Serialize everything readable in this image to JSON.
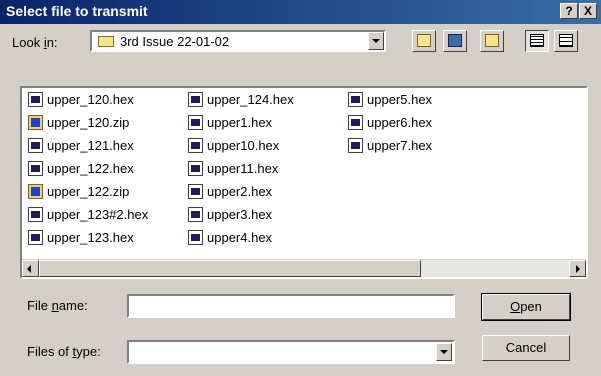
{
  "window": {
    "title": "Select file to transmit",
    "help_label": "?",
    "close_label": "X"
  },
  "lookin": {
    "label_pre": "Look ",
    "label_key": "i",
    "label_post": "n:",
    "value": "3rd Issue 22-01-02"
  },
  "toolbar": {
    "icons": [
      "up-one-level-icon",
      "desktop-icon",
      "new-folder-icon",
      "list-view-icon",
      "details-view-icon"
    ]
  },
  "files": [
    {
      "name": "upper_120.hex",
      "type": "hex"
    },
    {
      "name": "upper_120.zip",
      "type": "zip"
    },
    {
      "name": "upper_121.hex",
      "type": "hex"
    },
    {
      "name": "upper_122.hex",
      "type": "hex"
    },
    {
      "name": "upper_122.zip",
      "type": "zip"
    },
    {
      "name": "upper_123#2.hex",
      "type": "hex"
    },
    {
      "name": "upper_123.hex",
      "type": "hex"
    },
    {
      "name": "upper_124.hex",
      "type": "hex"
    },
    {
      "name": "upper1.hex",
      "type": "hex"
    },
    {
      "name": "upper10.hex",
      "type": "hex"
    },
    {
      "name": "upper11.hex",
      "type": "hex"
    },
    {
      "name": "upper2.hex",
      "type": "hex"
    },
    {
      "name": "upper3.hex",
      "type": "hex"
    },
    {
      "name": "upper4.hex",
      "type": "hex"
    },
    {
      "name": "upper5.hex",
      "type": "hex"
    },
    {
      "name": "upper6.hex",
      "type": "hex"
    },
    {
      "name": "upper7.hex",
      "type": "hex"
    }
  ],
  "filename": {
    "label_pre": "File ",
    "label_key": "n",
    "label_post": "ame:",
    "value": ""
  },
  "filetype": {
    "label_pre": "Files of ",
    "label_key": "t",
    "label_post": "ype:",
    "value": ""
  },
  "buttons": {
    "open_key": "O",
    "open_rest": "pen",
    "cancel_label": "Cancel"
  }
}
